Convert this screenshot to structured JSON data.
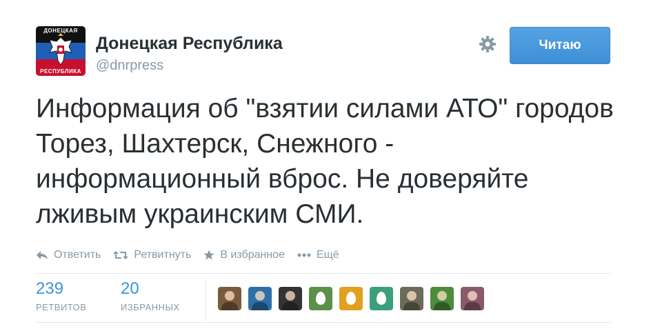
{
  "account": {
    "name": "Донецкая Республика",
    "handle": "@dnrpress",
    "avatar_caption_top": "ДОНЕЦКАЯ",
    "avatar_caption_bottom": "РЕСПУБЛИКА"
  },
  "follow_button": {
    "label": "Читаю"
  },
  "tweet": {
    "text": "Информация об \"взятии силами АТО\" городов Торез, Шахтерск, Снежного - информационный вброс. Не доверяйте лживым украинским СМИ."
  },
  "actions": [
    {
      "label": "Ответить",
      "icon": "reply-icon"
    },
    {
      "label": "Ретвитнуть",
      "icon": "retweet-icon"
    },
    {
      "label": "В избранное",
      "icon": "star-icon"
    },
    {
      "label": "Ещё",
      "icon": "more-icon"
    }
  ],
  "stats": {
    "retweets": {
      "count": "239",
      "label": "РЕТВИТОВ"
    },
    "favorites": {
      "count": "20",
      "label": "ИЗБРАННЫХ"
    }
  },
  "colors": {
    "accent": "#3b94d9",
    "button": "#4a9ae0",
    "muted": "#8899a6",
    "text": "#292f33"
  },
  "favoriters": [
    {
      "kind": "photo",
      "color": "#7a5a3c"
    },
    {
      "kind": "photo",
      "color": "#2d6fa8"
    },
    {
      "kind": "photo",
      "color": "#333333"
    },
    {
      "kind": "egg",
      "color": "#5c8f4a"
    },
    {
      "kind": "egg",
      "color": "#e0a020"
    },
    {
      "kind": "egg",
      "color": "#3aa07a"
    },
    {
      "kind": "photo",
      "color": "#6b6b5a"
    },
    {
      "kind": "photo",
      "color": "#4c8c3c"
    },
    {
      "kind": "photo",
      "color": "#8a5a6a"
    }
  ]
}
